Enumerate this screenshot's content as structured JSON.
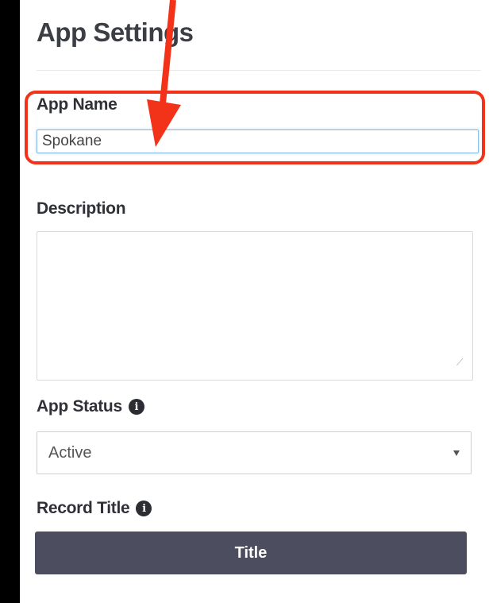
{
  "settings": {
    "heading": "App Settings",
    "app_name": {
      "label": "App Name",
      "value": "Spokane"
    },
    "description": {
      "label": "Description",
      "value": ""
    },
    "app_status": {
      "label": "App Status",
      "selected": "Active"
    },
    "record_title": {
      "label": "Record Title",
      "button_label": "Title"
    }
  },
  "annotation": {
    "color": "#f3321a"
  },
  "icons": {
    "info": "info-icon",
    "dropdown": "caret-down-icon"
  }
}
